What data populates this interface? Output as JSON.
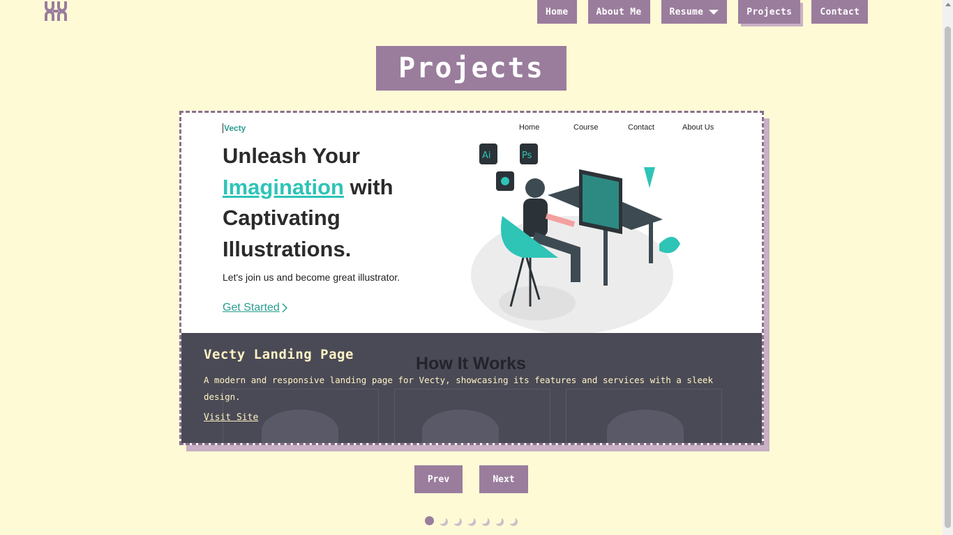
{
  "nav": {
    "items": [
      {
        "label": "Home"
      },
      {
        "label": "About Me"
      },
      {
        "label": "Resume"
      },
      {
        "label": "Projects"
      },
      {
        "label": "Contact"
      }
    ]
  },
  "page": {
    "title": "Projects"
  },
  "project": {
    "preview": {
      "brand": "Vecty",
      "nav": [
        "Home",
        "Course",
        "Contact",
        "About Us"
      ],
      "heading_part1": "Unleash Your",
      "heading_highlight": "Imagination",
      "heading_part2": "with Captivating Illustrations.",
      "subtext": "Let's join us and become great illustrator.",
      "cta": "Get Started",
      "section_heading": "How It Works"
    },
    "title": "Vecty Landing Page",
    "description": "A modern and responsive landing page for Vecty, showcasing its features and services with a sleek design.",
    "link": "Visit Site"
  },
  "controls": {
    "prev": "Prev",
    "next": "Next"
  },
  "pagination": {
    "total": 7,
    "active_index": 0
  },
  "colors": {
    "background": "#fefad6",
    "accent": "#9a7d9d",
    "overlay": "#4a4a56",
    "teal": "#2ec4b6"
  }
}
